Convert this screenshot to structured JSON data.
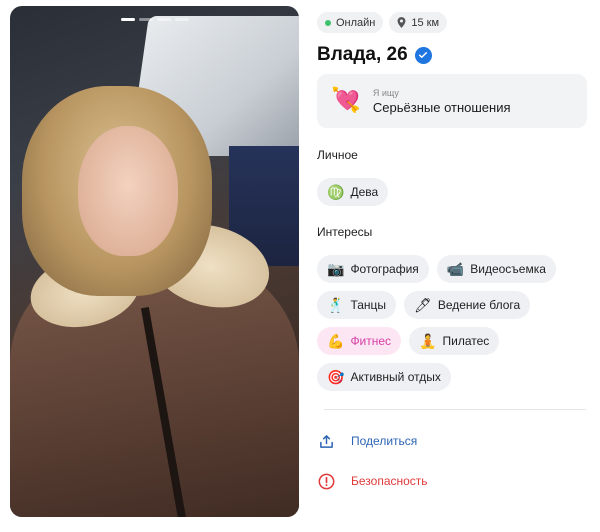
{
  "profile": {
    "status": "Онлайн",
    "distance": "15 км",
    "name": "Влада, 26",
    "photo_count": 4,
    "photo_index": 1
  },
  "seeking": {
    "emoji": "💘",
    "label": "Я ищу",
    "value": "Серьёзные отношения"
  },
  "personal": {
    "title": "Личное",
    "items": [
      {
        "icon": "♍",
        "label": "Дева"
      }
    ]
  },
  "interests": {
    "title": "Интересы",
    "items": [
      {
        "icon": "📷",
        "label": "Фотография"
      },
      {
        "icon": "📹",
        "label": "Видеосъемка"
      },
      {
        "icon": "🕺",
        "label": "Танцы"
      },
      {
        "icon": "🖊",
        "label": "Ведение блога"
      },
      {
        "icon": "💪",
        "label": "Фитнес"
      },
      {
        "icon": "🧘",
        "label": "Пилатес"
      },
      {
        "icon": "🎯",
        "label": "Активный отдых"
      }
    ]
  },
  "actions": {
    "share": "Поделиться",
    "safety": "Безопасность"
  },
  "colors": {
    "online": "#3ec16a",
    "verified": "#1f76e0",
    "share": "#2d64b3",
    "safety": "#e03a3a",
    "highlight_bg": "#fde6f4",
    "highlight_text": "#d53fa6"
  }
}
